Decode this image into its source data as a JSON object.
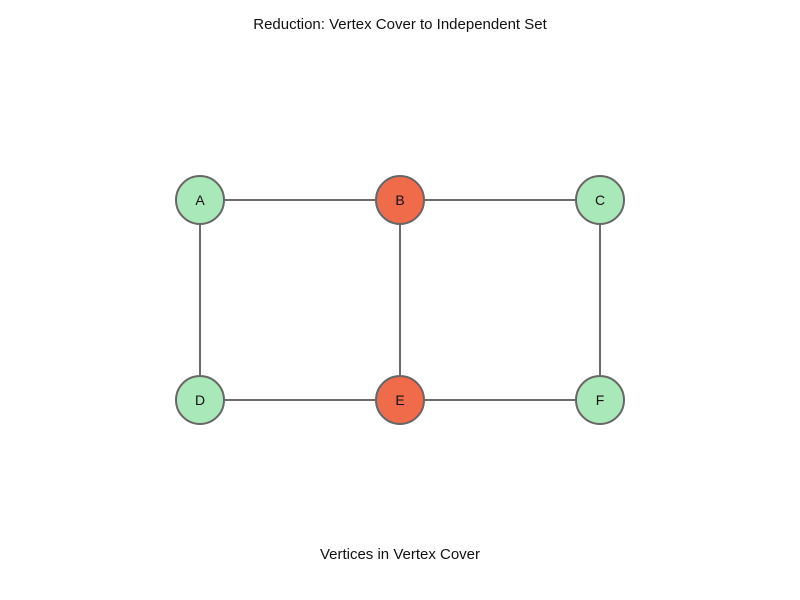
{
  "title": "Reduction: Vertex Cover to Independent Set",
  "caption": "Vertices in Vertex Cover",
  "colors": {
    "cover": "#ef6b4a",
    "independent": "#a9e8b8",
    "edge": "#6b6b6b",
    "outline": "#666666"
  },
  "nodes": [
    {
      "id": "A",
      "label": "A",
      "in_cover": false
    },
    {
      "id": "B",
      "label": "B",
      "in_cover": true
    },
    {
      "id": "C",
      "label": "C",
      "in_cover": false
    },
    {
      "id": "D",
      "label": "D",
      "in_cover": false
    },
    {
      "id": "E",
      "label": "E",
      "in_cover": true
    },
    {
      "id": "F",
      "label": "F",
      "in_cover": false
    }
  ],
  "edges": [
    [
      "A",
      "B"
    ],
    [
      "B",
      "C"
    ],
    [
      "A",
      "D"
    ],
    [
      "B",
      "E"
    ],
    [
      "C",
      "F"
    ],
    [
      "D",
      "E"
    ],
    [
      "E",
      "F"
    ]
  ]
}
